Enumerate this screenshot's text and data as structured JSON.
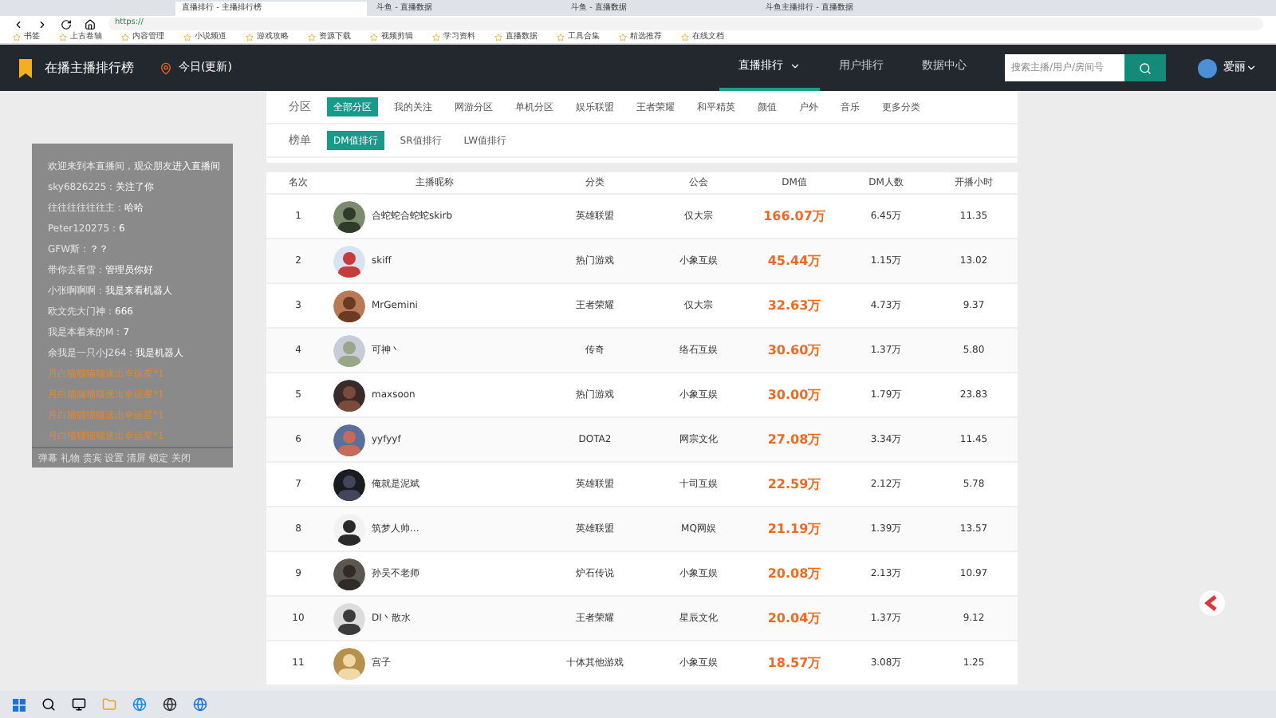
{
  "browser": {
    "tabs": [
      {
        "title": "直播排行 - 主播排行榜",
        "selected": true
      },
      {
        "title": "斗鱼 - 直播数据",
        "selected": false
      },
      {
        "title": "斗鱼 - 直播数据",
        "selected": false
      },
      {
        "title": "斗鱼主播排行 - 直播数据",
        "selected": false
      }
    ],
    "url": "https://",
    "bookmarks": [
      "书签",
      "上古卷轴",
      "内容管理",
      "小说频道",
      "游戏攻略",
      "资源下载",
      "视频剪辑",
      "学习资料",
      "直播数据",
      "工具合集",
      "精选推荐",
      "在线文档"
    ]
  },
  "header": {
    "title": "在播主播排行榜",
    "location": "今日(更新)",
    "nav": [
      {
        "label": "直播排行",
        "selected": true,
        "dropdown": true
      },
      {
        "label": "用户排行",
        "selected": false,
        "dropdown": false
      },
      {
        "label": "数据中心",
        "selected": false,
        "dropdown": false
      }
    ],
    "search": {
      "placeholder": "搜索主播/用户/房间号"
    },
    "user": "爱丽"
  },
  "filters": [
    {
      "label": "分区",
      "options": [
        {
          "label": "全部分区",
          "selected": true
        },
        {
          "label": "我的关注",
          "selected": false
        },
        {
          "label": "网游分区",
          "selected": false
        },
        {
          "label": "单机分区",
          "selected": false
        },
        {
          "label": "娱乐联盟",
          "selected": false
        },
        {
          "label": "王者荣耀",
          "selected": false
        },
        {
          "label": "和平精英",
          "selected": false
        },
        {
          "label": "颜值",
          "selected": false
        },
        {
          "label": "户外",
          "selected": false
        },
        {
          "label": "音乐",
          "selected": false
        },
        {
          "label": "更多分类",
          "selected": false
        }
      ]
    },
    {
      "label": "榜单",
      "options": [
        {
          "label": "DM值排行",
          "selected": true
        },
        {
          "label": "SR值排行",
          "selected": false
        },
        {
          "label": "LW值排行",
          "selected": false
        }
      ]
    }
  ],
  "table": {
    "columns": [
      "名次",
      "主播昵称",
      "分类",
      "公会",
      "DM值",
      "DM人数",
      "开播小时"
    ],
    "rows": [
      {
        "rank": "1",
        "name": "合蛇蛇合蛇蛇skirb",
        "category": "英雄联盟",
        "guild": "仅大宗",
        "dm": "166.07万",
        "dm_users": "6.45万",
        "hours": "11.35"
      },
      {
        "rank": "2",
        "name": "skiff",
        "category": "热门游戏",
        "guild": "小象互娱",
        "dm": "45.44万",
        "dm_users": "1.15万",
        "hours": "13.02"
      },
      {
        "rank": "3",
        "name": "MrGemini",
        "category": "王者荣耀",
        "guild": "仅大宗",
        "dm": "32.63万",
        "dm_users": "4.73万",
        "hours": "9.37"
      },
      {
        "rank": "4",
        "name": "可神丶",
        "category": "传奇",
        "guild": "络石互娱",
        "dm": "30.60万",
        "dm_users": "1.37万",
        "hours": "5.80"
      },
      {
        "rank": "5",
        "name": "maxsoon",
        "category": "热门游戏",
        "guild": "小象互娱",
        "dm": "30.00万",
        "dm_users": "1.79万",
        "hours": "23.83"
      },
      {
        "rank": "6",
        "name": "yyfyyf",
        "category": "DOTA2",
        "guild": "网宗文化",
        "dm": "27.08万",
        "dm_users": "3.34万",
        "hours": "11.45"
      },
      {
        "rank": "7",
        "name": "俺就是泥斌",
        "category": "英雄联盟",
        "guild": "十司互娱",
        "dm": "22.59万",
        "dm_users": "2.12万",
        "hours": "5.78"
      },
      {
        "rank": "8",
        "name": "筑梦人帅...",
        "category": "英雄联盟",
        "guild": "MQ网娱",
        "dm": "21.19万",
        "dm_users": "1.39万",
        "hours": "13.57"
      },
      {
        "rank": "9",
        "name": "孙吴不老师",
        "category": "炉石传说",
        "guild": "小象互娱",
        "dm": "20.08万",
        "dm_users": "2.13万",
        "hours": "10.97"
      },
      {
        "rank": "10",
        "name": "DI丶散水",
        "category": "王者荣耀",
        "guild": "星辰文化",
        "dm": "20.04万",
        "dm_users": "1.37万",
        "hours": "9.12"
      },
      {
        "rank": "11",
        "name": "宫子",
        "category": "十体其他游戏",
        "guild": "小象互娱",
        "dm": "18.57万",
        "dm_users": "3.08万",
        "hours": "1.25"
      }
    ]
  },
  "chat": {
    "lines": [
      {
        "kind": "notice",
        "user": "欢迎来到本直播间，观众朋友",
        "text": "进入直播间"
      },
      {
        "kind": "message",
        "user": "sky6826225：",
        "text": "关注了你"
      },
      {
        "kind": "message",
        "user": "往往往往往往主：",
        "text": "哈哈"
      },
      {
        "kind": "message",
        "user": "Peter120275：",
        "text": "6"
      },
      {
        "kind": "message",
        "user": "GFW斯：",
        "text": "？？"
      },
      {
        "kind": "message",
        "user": "带你去看雪：",
        "text": "管理员你好"
      },
      {
        "kind": "message",
        "user": "小张啊啊啊：",
        "text": "我是来看机器人"
      },
      {
        "kind": "message",
        "user": "欧文先大门神：",
        "text": "666"
      },
      {
        "kind": "message",
        "user": "我是本着来的M：",
        "text": "7"
      },
      {
        "kind": "message",
        "user": "余我是一只小J264：",
        "text": "我是机器人"
      },
      {
        "kind": "gift",
        "user": "月白猫猫猫猫",
        "text": "送出幸运星*1"
      },
      {
        "kind": "gift",
        "user": "月白猫猫猫猫",
        "text": "送出幸运星*1"
      },
      {
        "kind": "gift",
        "user": "月白猫猫猫猫",
        "text": "送出幸运星*1"
      },
      {
        "kind": "gift",
        "user": "月白猫猫猫猫",
        "text": "送出幸运星*1"
      }
    ],
    "footer": "弹幕 礼物 贵宾 设置 清屏 锁定 关闭"
  }
}
